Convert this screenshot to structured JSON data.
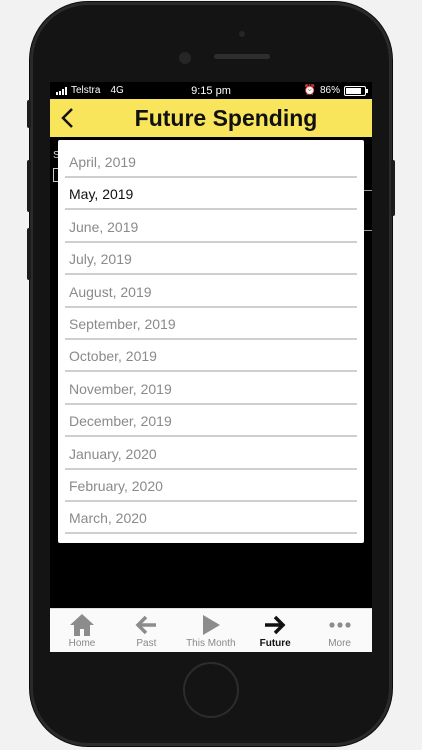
{
  "status_bar": {
    "carrier": "Telstra",
    "network": "4G",
    "time": "9:15 pm",
    "battery": "86%",
    "battery_level": 0.86
  },
  "header": {
    "title": "Future Spending",
    "background": "#f9e55c"
  },
  "behind": {
    "label": "S"
  },
  "picker": {
    "selected_index": 1,
    "options": [
      "April, 2019",
      "May, 2019",
      "June, 2019",
      "July, 2019",
      "August, 2019",
      "September, 2019",
      "October, 2019",
      "November, 2019",
      "December, 2019",
      "January, 2020",
      "February, 2020",
      "March, 2020"
    ]
  },
  "tabs": [
    {
      "label": "Home",
      "icon": "home-icon"
    },
    {
      "label": "Past",
      "icon": "arrow-left-icon"
    },
    {
      "label": "This Month",
      "icon": "play-icon"
    },
    {
      "label": "Future",
      "icon": "arrow-right-icon",
      "active": true
    },
    {
      "label": "More",
      "icon": "more-icon"
    }
  ]
}
